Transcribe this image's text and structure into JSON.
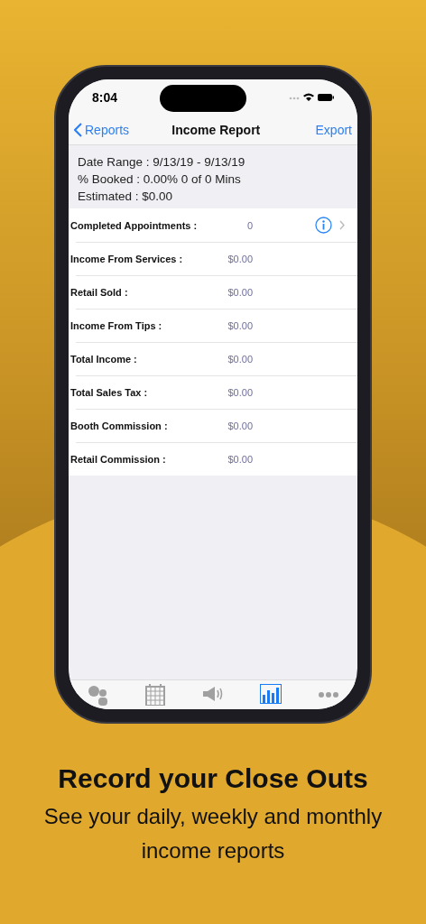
{
  "status_bar": {
    "time": "8:04"
  },
  "nav_bar": {
    "back": "Reports",
    "title": "Income Report",
    "action": "Export"
  },
  "summary": [
    "Date Range : 9/13/19 - 9/13/19",
    "% Booked : 0.00% 0 of 0 Mins",
    "Estimated : $0.00"
  ],
  "rows": [
    {
      "label": "Completed Appointments :",
      "value": "0",
      "kind": "detail"
    },
    {
      "label": "Income From Services :",
      "value": "$0.00",
      "kind": "plain"
    },
    {
      "label": "Retail Sold :",
      "value": "$0.00",
      "kind": "plain"
    },
    {
      "label": "Income From Tips :",
      "value": "$0.00",
      "kind": "plain"
    },
    {
      "label": "Total Income :",
      "value": "$0.00",
      "kind": "plain"
    },
    {
      "label": "Total Sales Tax :",
      "value": "$0.00",
      "kind": "plain"
    },
    {
      "label": "Booth Commission :",
      "value": "$0.00",
      "kind": "plain"
    },
    {
      "label": "Retail Commission :",
      "value": "$0.00",
      "kind": "plain"
    }
  ],
  "tab_bar": [
    {
      "kind": "clients",
      "selected": false
    },
    {
      "kind": "calendar",
      "selected": false
    },
    {
      "kind": "marketing",
      "selected": false
    },
    {
      "kind": "reports",
      "selected": true
    },
    {
      "kind": "more",
      "selected": false
    }
  ],
  "caption": {
    "heading": "Record your Close Outs",
    "subtitle": "See your daily, weekly and monthly income reports"
  }
}
